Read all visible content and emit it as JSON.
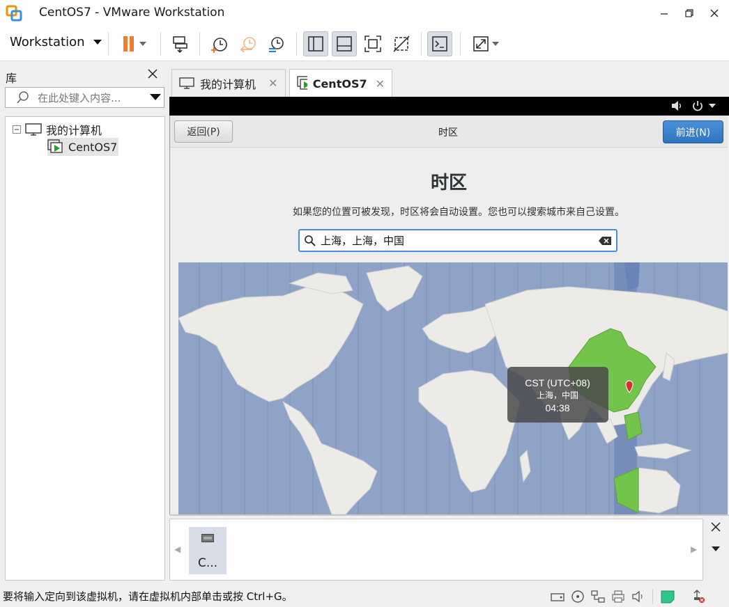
{
  "window": {
    "title": "CentOS7 - VMware Workstation"
  },
  "toolbar": {
    "workstation_label": "Workstation"
  },
  "library": {
    "title": "库",
    "search_placeholder": "在此处键入内容...",
    "tree": [
      {
        "label": "我的计算机"
      },
      {
        "label": "CentOS7"
      }
    ]
  },
  "tabs": [
    {
      "label": "我的计算机"
    },
    {
      "label": "CentOS7"
    }
  ],
  "installer": {
    "back_label": "返回(P)",
    "header_title": "时区",
    "next_label": "前进(N)",
    "heading": "时区",
    "description": "如果您的位置可被发现，时区将会自动设置。您也可以搜索城市来自己设置。",
    "search_value": "上海，上海，中国",
    "tooltip": {
      "zone": "CST (UTC+08)",
      "place": "上海，中国",
      "time": "04:38"
    }
  },
  "thumbnail": {
    "label": "C..."
  },
  "status": {
    "message": "要将输入定向到该虚拟机，请在虚拟机内部单击或按 Ctrl+G。"
  },
  "colors": {
    "accent": "#2f74c0",
    "map_water": "#8fa3c7",
    "map_land": "#ecebe8",
    "map_highlight": "#73c44b"
  }
}
